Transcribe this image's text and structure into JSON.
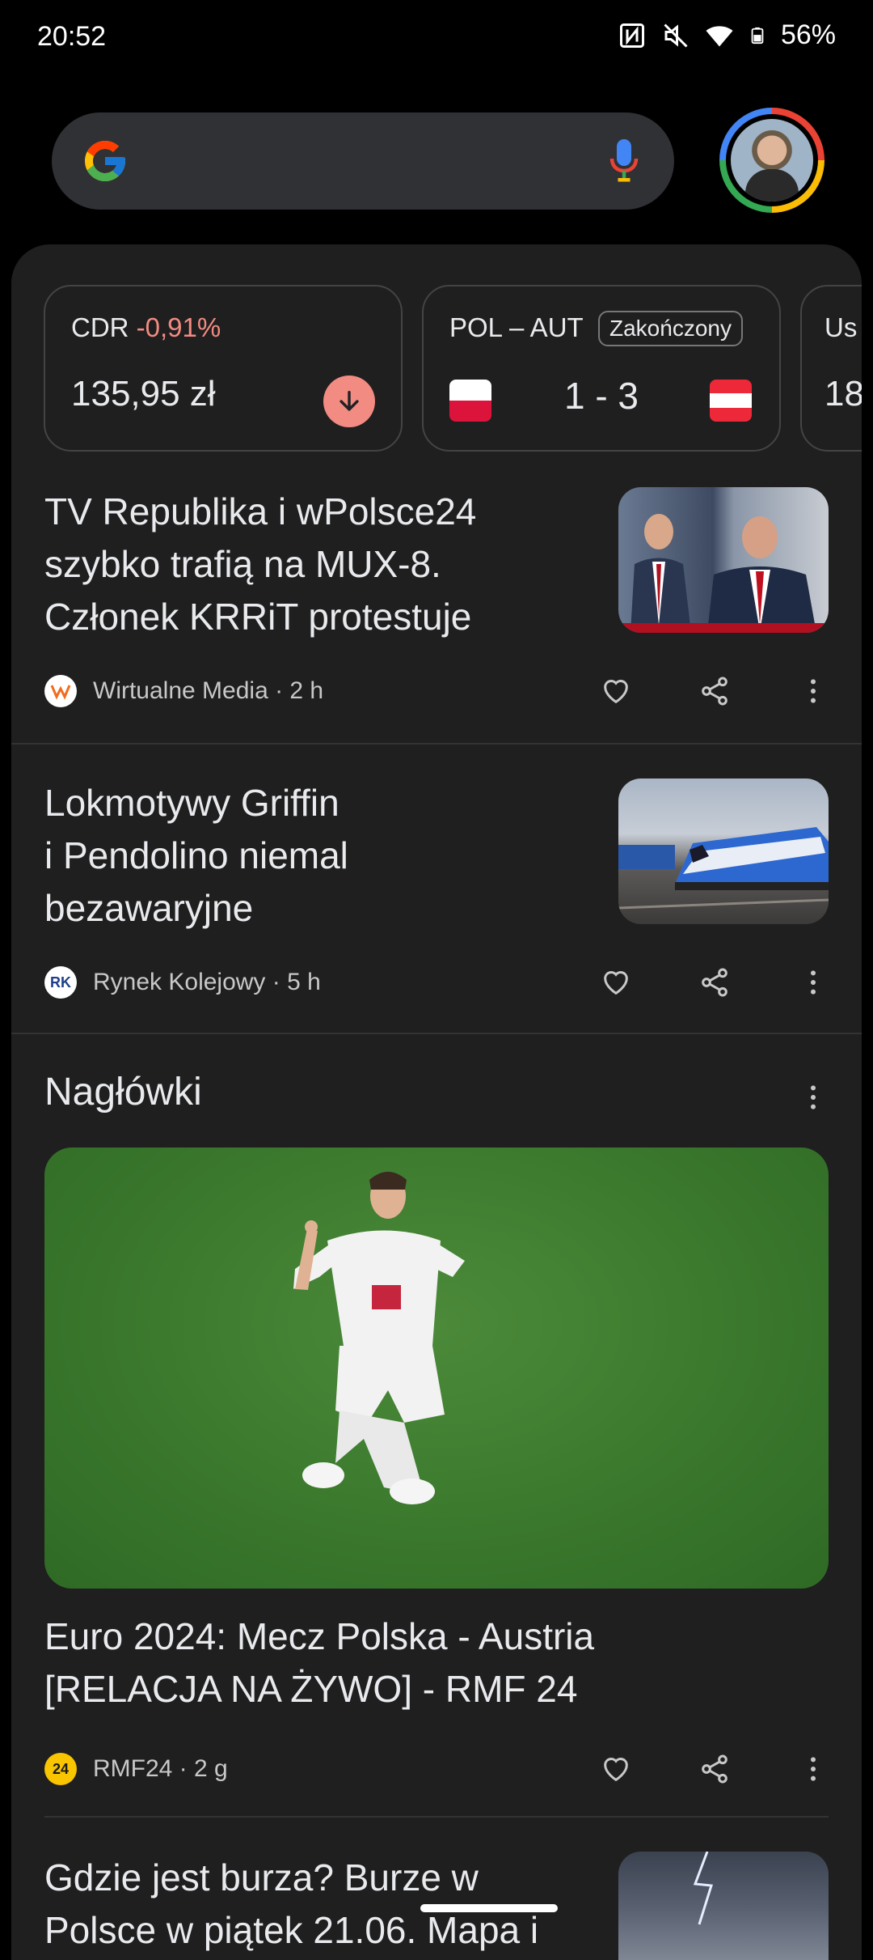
{
  "status_bar": {
    "time": "20:52",
    "battery": "56%"
  },
  "stock_card": {
    "ticker": "CDR",
    "change": "-0,91%",
    "price": "135,95 zł"
  },
  "match_card": {
    "teams": "POL – AUT",
    "status": "Zakończony",
    "score": "1 - 3"
  },
  "peek_card": {
    "title": "Us",
    "value": "18"
  },
  "articles": [
    {
      "title_lines": [
        "TV Republika i wPolsce24",
        "szybko trafią na MUX-8.",
        "Członek KRRiT protestuje"
      ],
      "source": "Wirtualne Media · 2 h"
    },
    {
      "title_lines": [
        "Lokmotywy Griffin",
        "i Pendolino niemal",
        "bezawaryjne"
      ],
      "source": "Rynek Kolejowy · 5 h"
    }
  ],
  "headlines": {
    "section_title": "Nagłówki",
    "hero_title_lines": [
      "Euro 2024: Mecz Polska - Austria",
      "[RELACJA NA ŻYWO] - RMF 24"
    ],
    "hero_source": "RMF24 · 2 g",
    "next_title_lines": [
      "Gdzie jest burza? Burze w",
      "Polsce w piątek 21.06. Mapa i"
    ]
  },
  "colors": {
    "negative": "#f28b82",
    "card_bg": "#1f1f1f"
  },
  "icons": [
    "nfc-icon",
    "mute-icon",
    "wifi-icon",
    "battery-icon",
    "google-logo-icon",
    "mic-icon",
    "arrow-down-icon",
    "heart-icon",
    "share-icon",
    "more-vert-icon"
  ]
}
